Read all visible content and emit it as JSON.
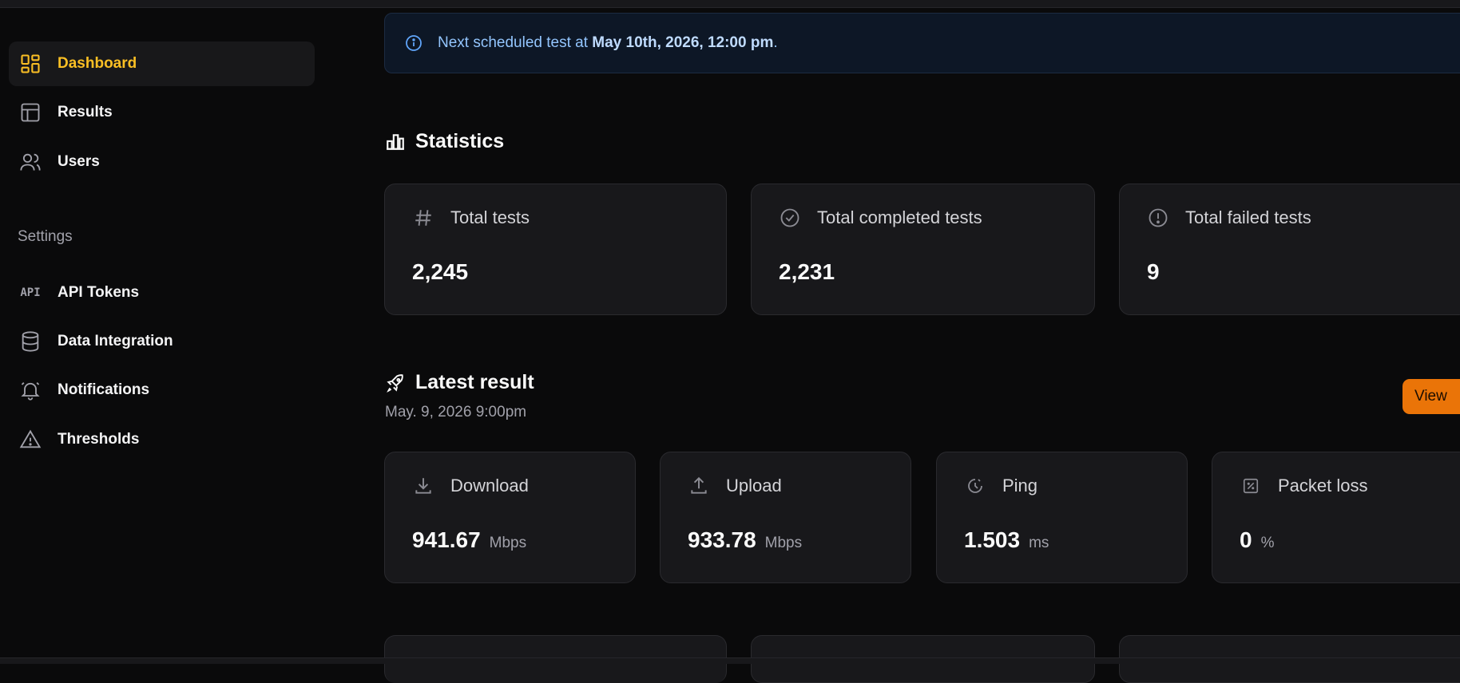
{
  "sidebar": {
    "items": [
      {
        "label": "Dashboard",
        "icon": "dashboard-icon",
        "active": true
      },
      {
        "label": "Results",
        "icon": "table-icon"
      },
      {
        "label": "Users",
        "icon": "users-icon"
      }
    ],
    "settings_label": "Settings",
    "settings_items": [
      {
        "label": "API Tokens",
        "icon": "api-icon",
        "icon_text": "API"
      },
      {
        "label": "Data Integration",
        "icon": "database-icon"
      },
      {
        "label": "Notifications",
        "icon": "bell-icon"
      },
      {
        "label": "Thresholds",
        "icon": "warning-icon"
      }
    ]
  },
  "banner": {
    "prefix": "Next scheduled test at ",
    "datetime": "May 10th, 2026, 12:00 pm",
    "suffix": "."
  },
  "statistics": {
    "title": "Statistics",
    "cards": [
      {
        "label": "Total tests",
        "value": "2,245",
        "icon": "hash-icon"
      },
      {
        "label": "Total completed tests",
        "value": "2,231",
        "icon": "check-circle-icon"
      },
      {
        "label": "Total failed tests",
        "value": "9",
        "icon": "exclamation-circle-icon"
      }
    ]
  },
  "latest": {
    "title": "Latest result",
    "timestamp": "May. 9, 2026 9:00pm",
    "view_label": "View",
    "cards": [
      {
        "label": "Download",
        "value": "941.67",
        "unit": "Mbps",
        "icon": "download-icon"
      },
      {
        "label": "Upload",
        "value": "933.78",
        "unit": "Mbps",
        "icon": "upload-icon"
      },
      {
        "label": "Ping",
        "value": "1.503",
        "unit": "ms",
        "icon": "clock-icon"
      },
      {
        "label": "Packet loss",
        "value": "0",
        "unit": "%",
        "icon": "percent-icon"
      }
    ]
  },
  "colors": {
    "accent": "#fbbf24",
    "view_button": "#ea7408",
    "banner_text": "#93c5fd",
    "background": "#0a0a0b",
    "card": "#18181b"
  }
}
